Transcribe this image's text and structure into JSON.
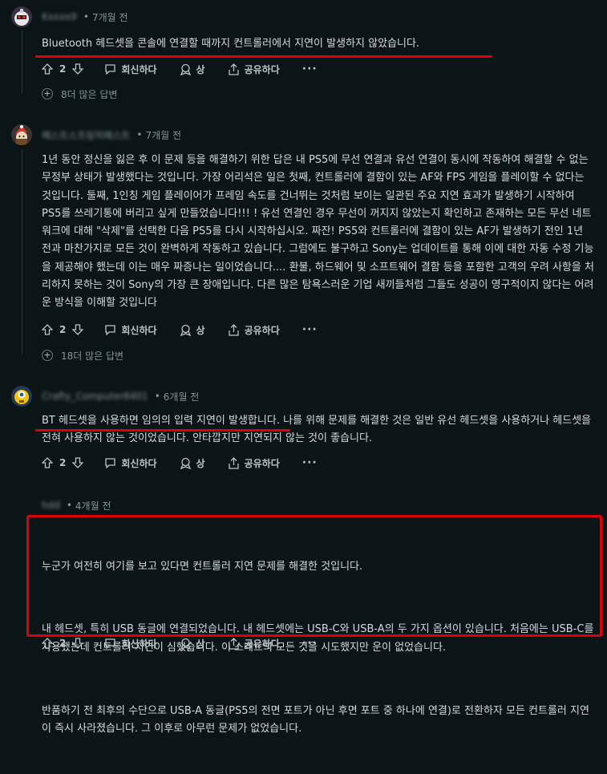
{
  "comments": [
    {
      "time": "7개월 전",
      "text": "Bluetooth 헤드셋을 콘솔에 연결할 때까지 컨트롤러에서 지연이 발생하지 않았습니다.",
      "votes": "2",
      "reply_label": "회신하다",
      "award_label": "상",
      "share_label": "공유하다",
      "more_replies": "8더 많은 답변"
    },
    {
      "time": "7개월 전",
      "text": "1년 동안 정신을 잃은 후 이 문제 등을 해결하기 위한 답은 내 PS5에 무선 연결과 유선 연결이 동시에 작동하여 해결할 수 없는 무정부 상태가 발생했다는 것입니다. 가장 어리석은 일은 첫째, 컨트롤러에 결함이 있는 AF와 FPS 게임을 플레이할 수 없다는 것입니다. 둘째, 1인칭 게임 플레이어가 프레임 속도를 건너뛰는 것처럼 보이는 일관된 주요 지연 효과가 발생하기 시작하여 PS5를 쓰레기통에 버리고 싶게 만들었습니다!!! ! 유선 연결인 경우 무선이 꺼지지 않았는지 확인하고 존재하는 모든 무선 네트워크에 대해 \"삭제\"를 선택한 다음 PS5를 다시 시작하십시오. 짜잔! PS5와 컨트롤러에 결함이 있는 AF가 발생하기 전인 1년 전과 마찬가지로 모든 것이 완벽하게 작동하고 있습니다. 그럼에도 불구하고 Sony는 업데이트를 통해 이에 대한 자동 수정 기능을 제공해야 했는데 이는 매우 짜증나는 일이었습니다.... 환불, 하드웨어 및 소프트웨어 결함 등을 포함한 고객의 우려 사항을 처리하지 못하는 것이 Sony의 가장 큰 장애입니다. 다른 많은 탐욕스러운 기업 새끼들처럼 그들도 성공이 영구적이지 않다는 어려운 방식을 이해할 것입니다",
      "votes": "2",
      "reply_label": "회신하다",
      "award_label": "상",
      "share_label": "공유하다",
      "more_replies": "18더 많은 답변"
    },
    {
      "time": "6개월 전",
      "text": "BT 헤드셋을 사용하면 임의의 입력 지연이 발생합니다. 나를 위해 문제를 해결한 것은 일반 유선 헤드셋을 사용하거나 헤드셋을 전혀 사용하지 않는 것이었습니다. 안타깝지만 지연되지 않는 것이 좋습니다.",
      "votes": "2",
      "reply_label": "회신하다",
      "award_label": "상",
      "share_label": "공유하다"
    },
    {
      "time": "4개월 전",
      "paragraphs": [
        "누군가 여전히 여기를 보고 있다면 컨트롤러 지연 문제를 해결한 것입니다.",
        "내 헤드셋, 특히 USB 동글에 연결되었습니다. 내 헤드셋에는 USB-C와 USB-A의 두 가지 옵션이 있습니다. 처음에는 USB-C를 사용했는데 컨트롤러 지연이 심했습니다. 이 스레드의 모든 것을 시도했지만 운이 없었습니다.",
        "반품하기 전 최후의 수단으로 USB-A 동글(PS5의 전면 포트가 아닌 후면 포트 중 하나에 연결)로 전환하자 모든 컨트롤러 지연이 즉시 사라졌습니다. 그 이후로 아무런 문제가 없었습니다."
      ],
      "votes": "2",
      "reply_label": "회신하다",
      "award_label": "상",
      "share_label": "공유하다"
    }
  ],
  "colors": {
    "background": "#0b1416",
    "text": "#d7dadc",
    "meta": "#82959b",
    "highlight": "#e0000a"
  }
}
